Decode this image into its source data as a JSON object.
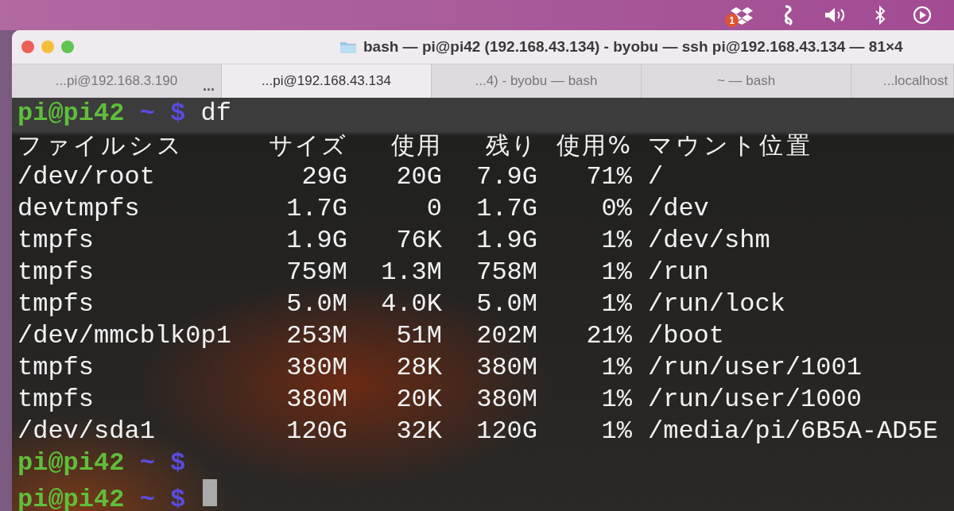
{
  "menubar": {
    "badge": "1"
  },
  "window": {
    "title": "bash — pi@pi42 (192.168.43.134) - byobu — ssh pi@192.168.43.134 — 81×4"
  },
  "tabs": [
    {
      "label": "...pi@192.168.3.190",
      "selected": false,
      "overflow": "..."
    },
    {
      "label": "...pi@192.168.43.134",
      "selected": true
    },
    {
      "label": "...4) - byobu — bash",
      "selected": false
    },
    {
      "label": "~ — bash",
      "selected": false
    },
    {
      "label": "...localhost",
      "selected": false
    }
  ],
  "terminal": {
    "lines": [
      {
        "kind": "prompt",
        "user": "pi@pi42",
        "path": "~",
        "symbol": "$",
        "command": "df",
        "cursor": false
      },
      {
        "kind": "table",
        "columns": [
          "ファイルシス",
          "サイズ",
          "使用",
          "残り",
          "使用%",
          "マウント位置"
        ],
        "rows": [
          [
            "/dev/root",
            "29G",
            "20G",
            "7.9G",
            "71%",
            "/"
          ],
          [
            "devtmpfs",
            "1.7G",
            "0",
            "1.7G",
            "0%",
            "/dev"
          ],
          [
            "tmpfs",
            "1.9G",
            "76K",
            "1.9G",
            "1%",
            "/dev/shm"
          ],
          [
            "tmpfs",
            "759M",
            "1.3M",
            "758M",
            "1%",
            "/run"
          ],
          [
            "tmpfs",
            "5.0M",
            "4.0K",
            "5.0M",
            "1%",
            "/run/lock"
          ],
          [
            "/dev/mmcblk0p1",
            "253M",
            "51M",
            "202M",
            "21%",
            "/boot"
          ],
          [
            "tmpfs",
            "380M",
            "28K",
            "380M",
            "1%",
            "/run/user/1001"
          ],
          [
            "tmpfs",
            "380M",
            "20K",
            "380M",
            "1%",
            "/run/user/1000"
          ],
          [
            "/dev/sda1",
            "120G",
            "32K",
            "120G",
            "1%",
            "/media/pi/6B5A-AD5E"
          ]
        ]
      },
      {
        "kind": "prompt",
        "user": "pi@pi42",
        "path": "~",
        "symbol": "$",
        "cursor": false
      },
      {
        "kind": "prompt",
        "user": "pi@pi42",
        "path": "~",
        "symbol": "$",
        "cursor": true
      }
    ]
  }
}
